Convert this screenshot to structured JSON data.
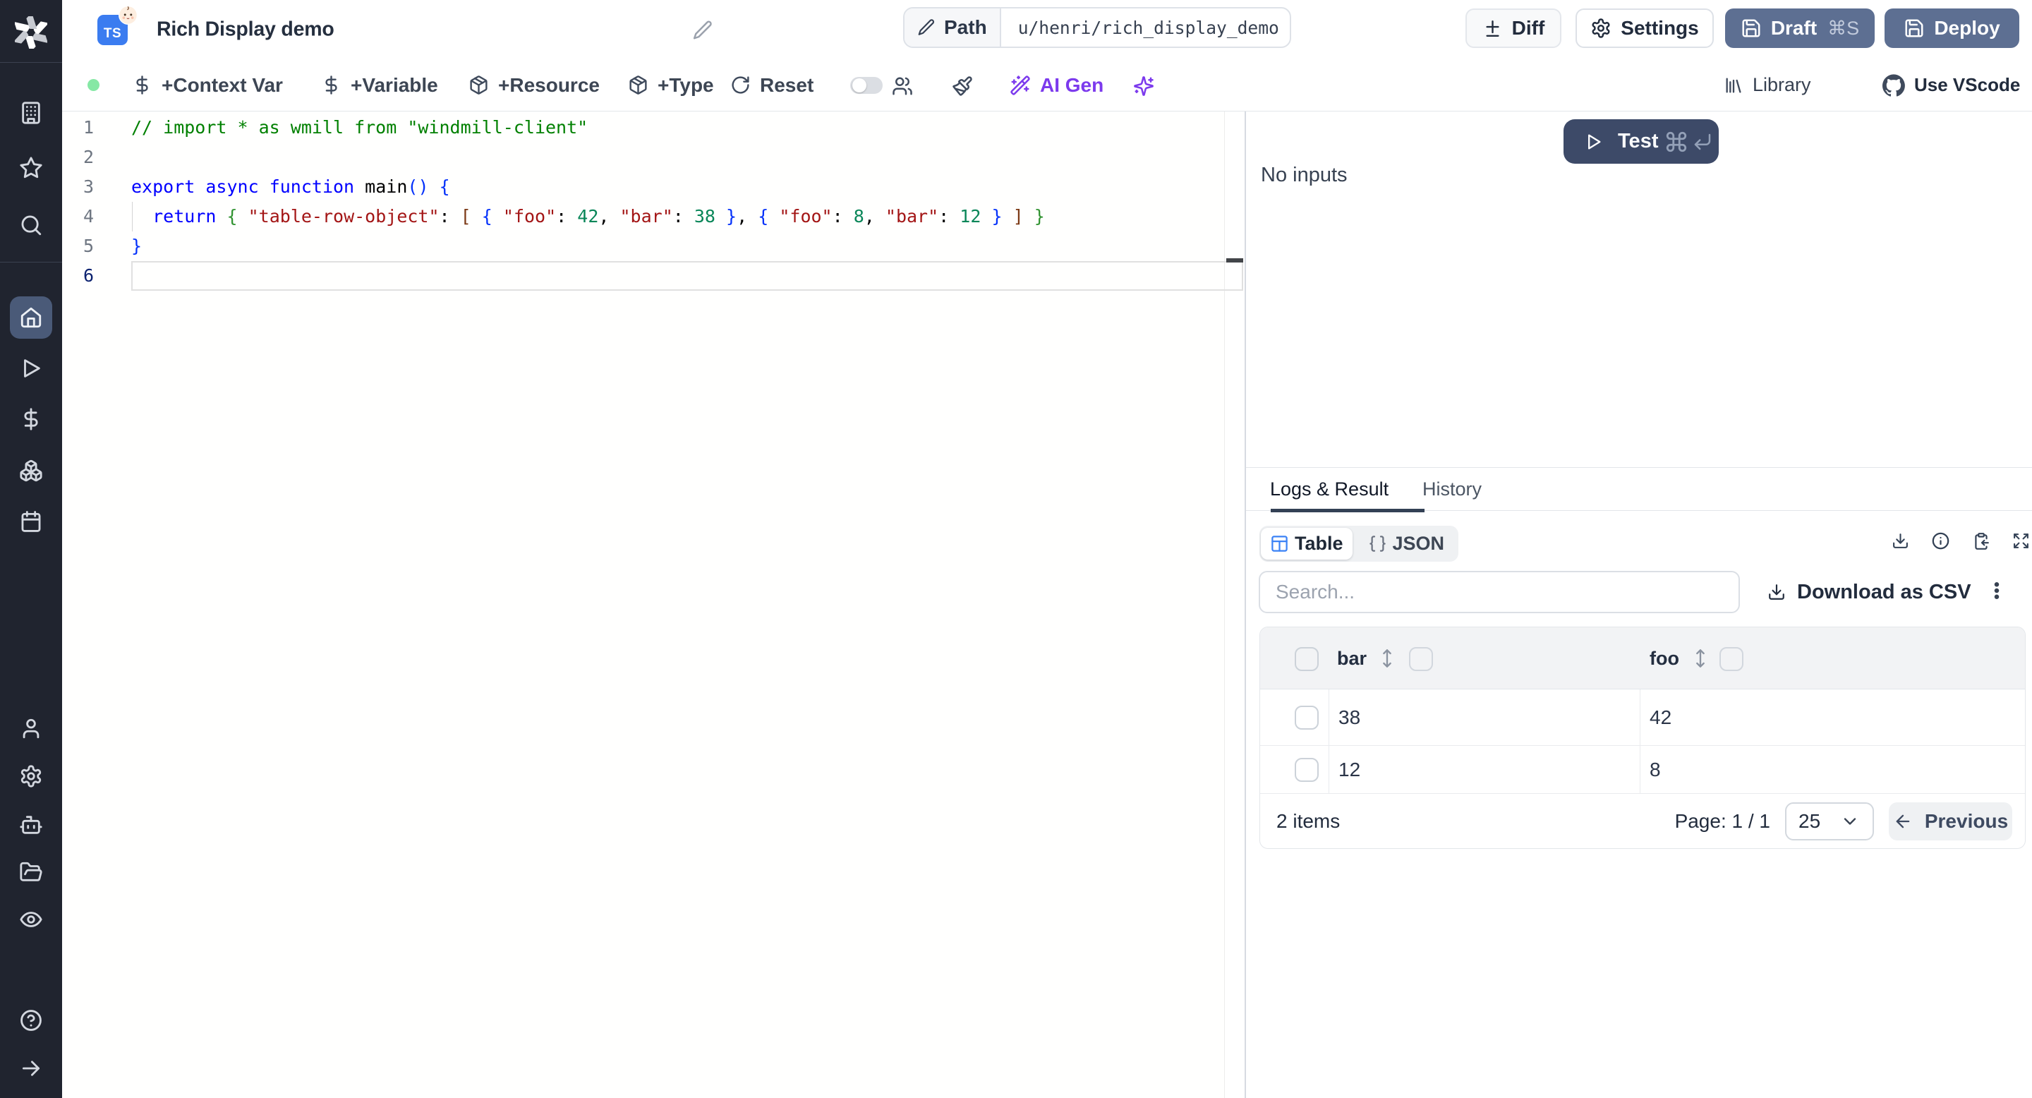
{
  "app": "Windmill script editor",
  "sidebar": {
    "items_top": [
      "workspace",
      "favorites",
      "search"
    ],
    "items_main": [
      "home",
      "runs",
      "variables",
      "resources",
      "schedules"
    ],
    "active_item": "home",
    "items_bottom": [
      "workers",
      "settings",
      "worker-groups",
      "folders",
      "audit-logs"
    ],
    "items_footer": [
      "help",
      "collapse"
    ]
  },
  "header": {
    "language_badge": "TS",
    "title": "Rich Display demo",
    "path_label": "Path",
    "path_value": "u/henri/rich_display_demo",
    "buttons": {
      "diff": "Diff",
      "settings": "Settings",
      "draft": "Draft",
      "draft_shortcut": "⌘S",
      "deploy": "Deploy"
    }
  },
  "toolbar": {
    "status": "connected",
    "items": [
      {
        "id": "context-var",
        "label": "+Context Var"
      },
      {
        "id": "variable",
        "label": "+Variable"
      },
      {
        "id": "resource",
        "label": "+Resource"
      },
      {
        "id": "type",
        "label": "+Type"
      },
      {
        "id": "reset",
        "label": "Reset"
      },
      {
        "id": "ai-gen",
        "label": "AI Gen"
      }
    ],
    "assistant_toggle": "off",
    "right": {
      "library": "Library",
      "vscode": "Use VScode"
    }
  },
  "editor": {
    "language": "typescript",
    "current_line": 6,
    "lines": [
      {
        "n": "1",
        "tokens": [
          {
            "t": "// import * as wmill from \"windmill-client\"",
            "c": "cmt"
          }
        ]
      },
      {
        "n": "2",
        "tokens": []
      },
      {
        "n": "3",
        "tokens": [
          {
            "t": "export",
            "c": "kw"
          },
          {
            "t": " ",
            "c": "pl"
          },
          {
            "t": "async",
            "c": "kw"
          },
          {
            "t": " ",
            "c": "pl"
          },
          {
            "t": "function",
            "c": "kw"
          },
          {
            "t": " main",
            "c": "pl"
          },
          {
            "t": "()",
            "c": "b1"
          },
          {
            "t": " ",
            "c": "pl"
          },
          {
            "t": "{",
            "c": "b1"
          }
        ]
      },
      {
        "n": "4",
        "tokens": [
          {
            "t": "  ",
            "c": "pl"
          },
          {
            "t": "return",
            "c": "kw"
          },
          {
            "t": " ",
            "c": "pl"
          },
          {
            "t": "{",
            "c": "b2"
          },
          {
            "t": " ",
            "c": "pl"
          },
          {
            "t": "\"table-row-object\"",
            "c": "str"
          },
          {
            "t": ": ",
            "c": "pl"
          },
          {
            "t": "[",
            "c": "b3"
          },
          {
            "t": " ",
            "c": "pl"
          },
          {
            "t": "{",
            "c": "b1"
          },
          {
            "t": " ",
            "c": "pl"
          },
          {
            "t": "\"foo\"",
            "c": "str"
          },
          {
            "t": ": ",
            "c": "pl"
          },
          {
            "t": "42",
            "c": "num"
          },
          {
            "t": ", ",
            "c": "pl"
          },
          {
            "t": "\"bar\"",
            "c": "str"
          },
          {
            "t": ": ",
            "c": "pl"
          },
          {
            "t": "38",
            "c": "num"
          },
          {
            "t": " ",
            "c": "pl"
          },
          {
            "t": "}",
            "c": "b1"
          },
          {
            "t": ", ",
            "c": "pl"
          },
          {
            "t": "{",
            "c": "b1"
          },
          {
            "t": " ",
            "c": "pl"
          },
          {
            "t": "\"foo\"",
            "c": "str"
          },
          {
            "t": ": ",
            "c": "pl"
          },
          {
            "t": "8",
            "c": "num"
          },
          {
            "t": ", ",
            "c": "pl"
          },
          {
            "t": "\"bar\"",
            "c": "str"
          },
          {
            "t": ": ",
            "c": "pl"
          },
          {
            "t": "12",
            "c": "num"
          },
          {
            "t": " ",
            "c": "pl"
          },
          {
            "t": "}",
            "c": "b1"
          },
          {
            "t": " ",
            "c": "pl"
          },
          {
            "t": "]",
            "c": "b3"
          },
          {
            "t": " ",
            "c": "pl"
          },
          {
            "t": "}",
            "c": "b2"
          }
        ]
      },
      {
        "n": "5",
        "tokens": [
          {
            "t": "}",
            "c": "b1"
          }
        ]
      },
      {
        "n": "6",
        "tokens": []
      }
    ]
  },
  "run_panel": {
    "test_button": "Test",
    "test_shortcut": "⌘↵",
    "no_inputs": "No inputs",
    "tabs": [
      {
        "label": "Logs & Result",
        "active": true
      },
      {
        "label": "History",
        "active": false
      }
    ],
    "result_views": [
      {
        "label": "Table",
        "active": true
      },
      {
        "label": "JSON",
        "active": false
      }
    ],
    "search_placeholder": "Search...",
    "download_csv": "Download as CSV"
  },
  "result_table": {
    "columns": [
      "bar",
      "foo"
    ],
    "rows": [
      [
        "38",
        "42"
      ],
      [
        "12",
        "8"
      ]
    ],
    "footer": {
      "items": "2 items",
      "page": "Page: 1 / 1",
      "page_size": "25",
      "previous": "Previous"
    }
  }
}
